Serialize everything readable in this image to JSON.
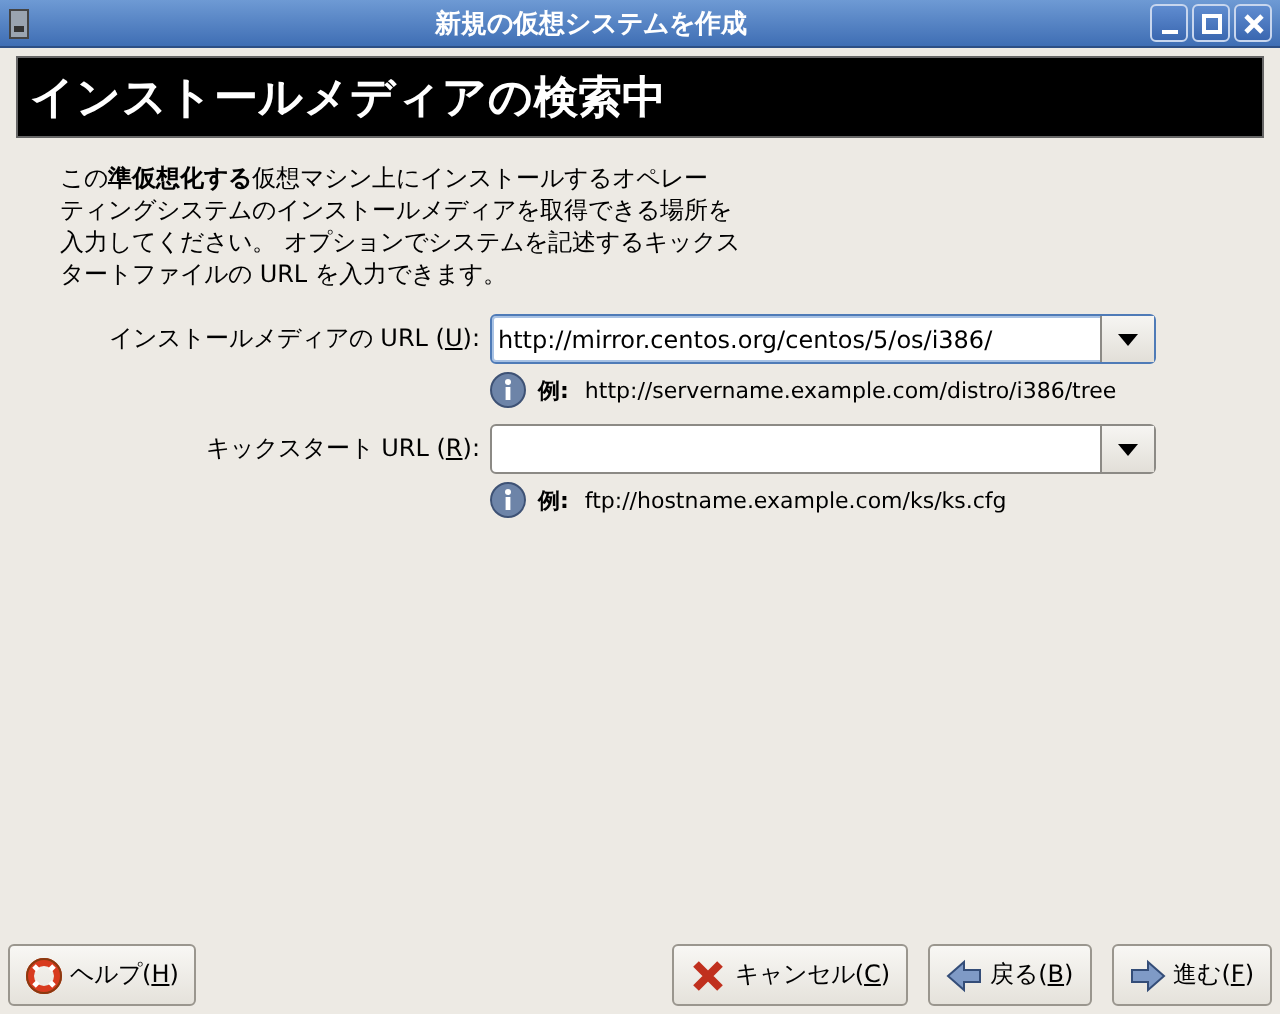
{
  "window": {
    "title": "新規の仮想システムを作成"
  },
  "banner": {
    "title": "インストールメディアの検索中"
  },
  "description": [
    "この**準仮想化する**仮想マシン上にインストールするオペレー",
    "ティングシステムのインストールメディアを取得できる場所を",
    "入力してください。 オプションでシステムを記述するキックス",
    "タートファイルの  URL を入力できます。"
  ],
  "fields": [
    {
      "label": [
        "インストールメディアの  URL (",
        "U",
        "):"
      ],
      "value": "http://mirror.centos.org/centos/5/os/i386/",
      "focused": true,
      "hint_label": "例:",
      "hint": "http://servername.example.com/distro/i386/tree"
    },
    {
      "label": [
        "キックスタート  URL (",
        "R",
        "):"
      ],
      "focused": false,
      "hint_label": "例:",
      "hint": "ftp://hostname.example.com/ks/ks.cfg"
    }
  ],
  "buttons": [
    {
      "kind": "help",
      "label": [
        "ヘルプ(",
        "H",
        ")"
      ]
    },
    {
      "kind": "cancel",
      "label": [
        "キャンセル(",
        "C",
        ")"
      ]
    },
    {
      "kind": "back",
      "label": [
        "戻る(",
        "B",
        ")"
      ]
    },
    {
      "kind": "forward",
      "label": [
        "進む(",
        "F",
        ")"
      ]
    }
  ]
}
